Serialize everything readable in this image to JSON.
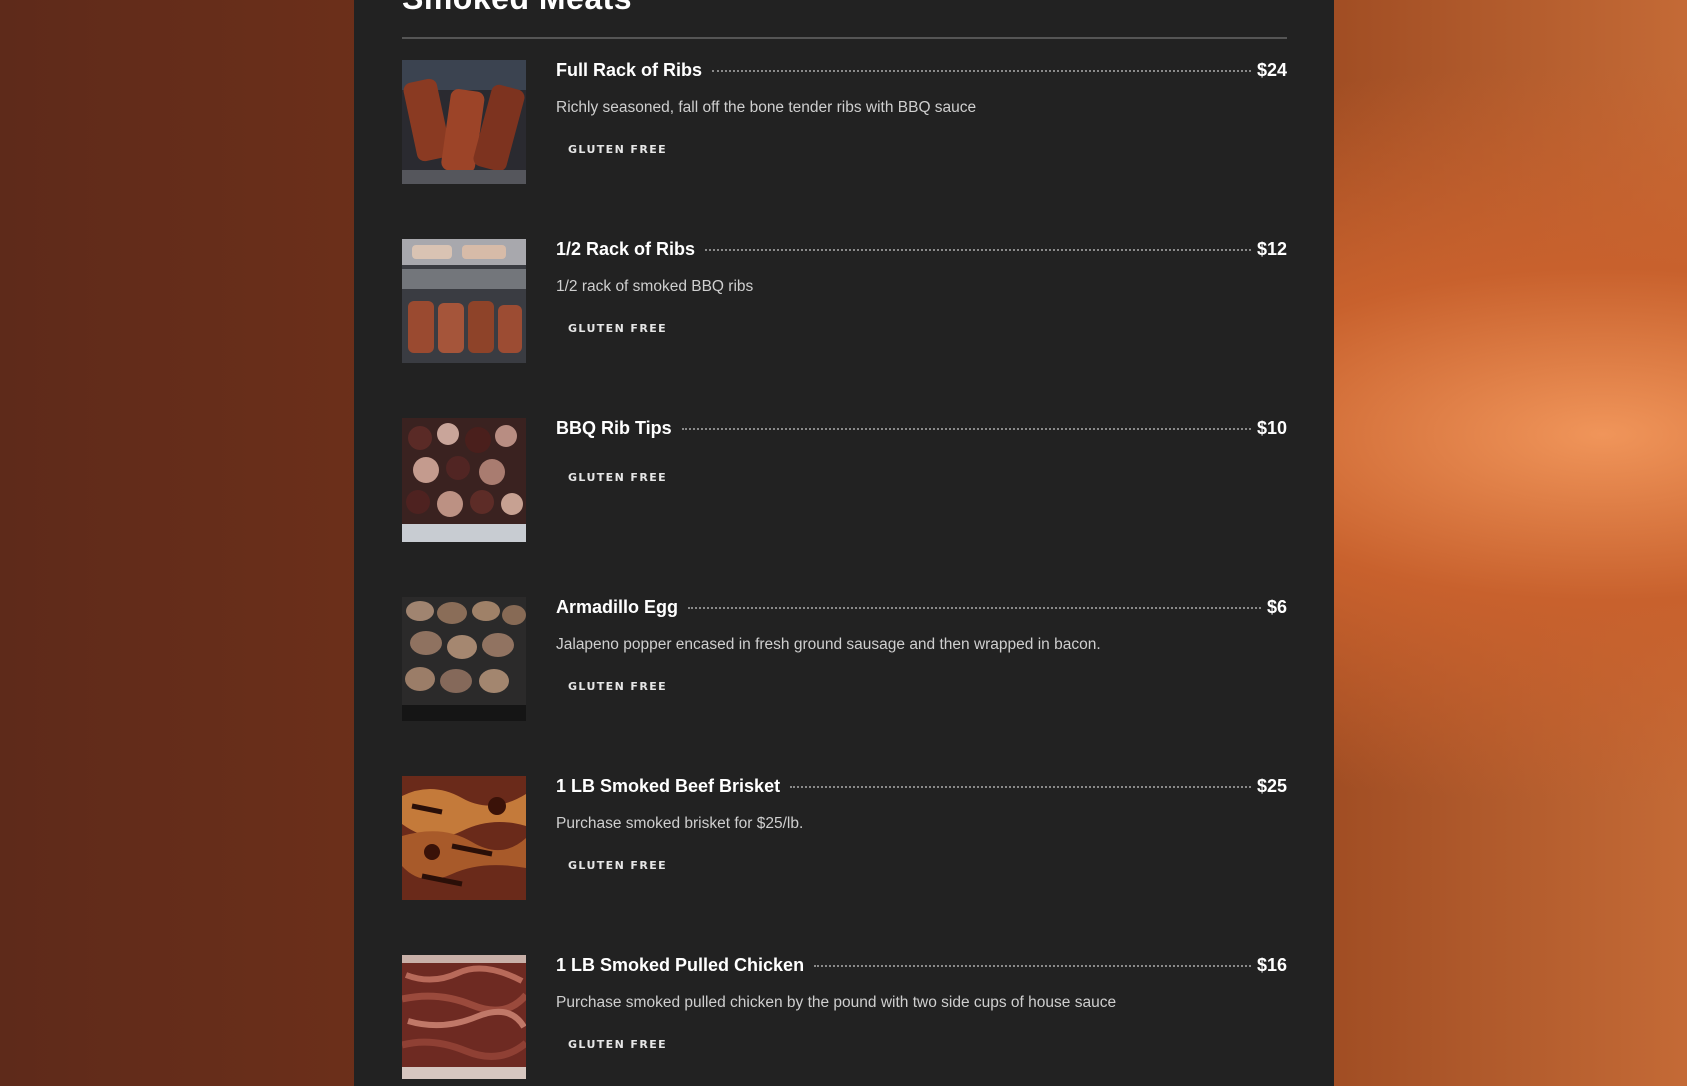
{
  "section": {
    "title": "Smoked Meats"
  },
  "items": [
    {
      "name": "Full Rack of Ribs",
      "price": "$24",
      "description": "Richly seasoned, fall off the bone tender ribs with BBQ sauce",
      "tag": "GLUTEN FREE"
    },
    {
      "name": "1/2 Rack of Ribs",
      "price": "$12",
      "description": "1/2 rack of smoked BBQ ribs",
      "tag": "GLUTEN FREE"
    },
    {
      "name": "BBQ Rib Tips",
      "price": "$10",
      "description": "",
      "tag": "GLUTEN FREE"
    },
    {
      "name": "Armadillo Egg",
      "price": "$6",
      "description": "Jalapeno popper encased in fresh ground sausage and then wrapped in bacon.",
      "tag": "GLUTEN FREE"
    },
    {
      "name": "1 LB Smoked Beef Brisket",
      "price": "$25",
      "description": "Purchase smoked brisket for $25/lb.",
      "tag": "GLUTEN FREE"
    },
    {
      "name": "1 LB Smoked Pulled Chicken",
      "price": "$16",
      "description": "Purchase smoked pulled chicken by the pound with two side cups of house sauce",
      "tag": "GLUTEN FREE"
    }
  ],
  "colors": {
    "panel": "#222222",
    "text": "#ffffff",
    "muted": "#cfcfcf"
  }
}
